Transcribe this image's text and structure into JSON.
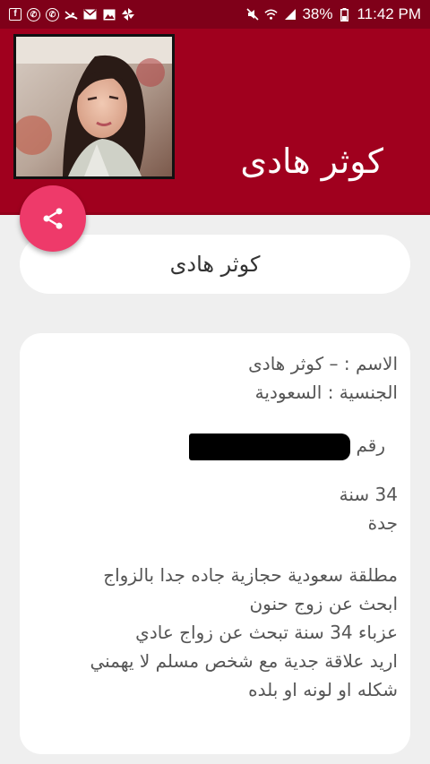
{
  "status_bar": {
    "left_icons": [
      "facebook-icon",
      "whatsapp-icon",
      "whatsapp-icon",
      "missed-call-icon",
      "gmail-icon",
      "gallery-icon",
      "pinwheel-icon"
    ],
    "battery": "38%",
    "time": "11:42 PM"
  },
  "header": {
    "title": "كوثر هادى",
    "color": "#a0001e"
  },
  "name_pill": {
    "text": "كوثر هادى"
  },
  "profile": {
    "name_line": "الاسم :  – كوثر هادى",
    "nationality_line": "الجنسية : السعودية",
    "phone_label": "رقم",
    "age_line": "34 سنة",
    "city_line": "جدة",
    "bio_lines": [
      "مطلقة سعودية حجازية جاده جدا بالزواج",
      "ابحث عن زوج حنون",
      "عزباء 34 سنة تبحث عن زواج عادي",
      "اريد علاقة جدية مع شخص مسلم لا يهمني",
      "شكله او لونه او بلده"
    ]
  },
  "colors": {
    "statusbar": "#7f0019",
    "header": "#a0001e",
    "fab": "#ee3a6a",
    "background": "#efefef"
  }
}
